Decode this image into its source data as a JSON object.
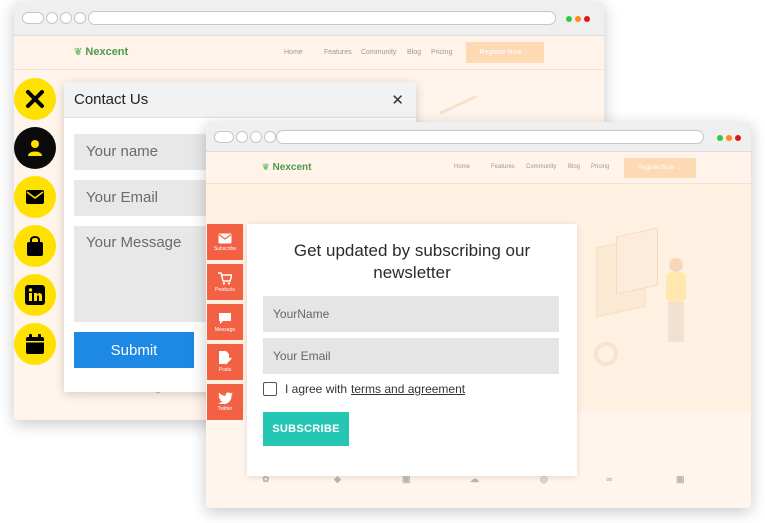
{
  "back_window": {
    "logo": "Nexcent",
    "nav": [
      "Home",
      "Features",
      "Community",
      "Blog",
      "Pricing"
    ],
    "register": "Register Now →"
  },
  "side_buttons": [
    {
      "icon": "close-icon",
      "style": "yellow"
    },
    {
      "icon": "user-icon",
      "style": "dark"
    },
    {
      "icon": "mail-icon",
      "style": "yellow"
    },
    {
      "icon": "bag-icon",
      "style": "yellow"
    },
    {
      "icon": "linkedin-icon",
      "style": "yellow"
    },
    {
      "icon": "calendar-icon",
      "style": "yellow"
    }
  ],
  "contact_form": {
    "title": "Contact Us",
    "close": "✕",
    "name_placeholder": "Your name",
    "email_placeholder": "Your Email",
    "message_placeholder": "Your Message",
    "submit": "Submit"
  },
  "front_window": {
    "logo": "Nexcent",
    "nav": [
      "Home",
      "Features",
      "Community",
      "Blog",
      "Pricing"
    ],
    "register": "Register Now →",
    "tabs": [
      "Subscribe",
      "Products",
      "Message",
      "Posts",
      "Twitter"
    ]
  },
  "newsletter": {
    "title_line1": "Get updated by subscribing our",
    "title_line2": "newsletter",
    "name_placeholder": "YourName",
    "email_placeholder": "Your Email",
    "agree_text": "I agree with",
    "terms_link": "terms and agreement",
    "subscribe": "SUBSCRIBE"
  },
  "colors": {
    "yellow": "#ffe100",
    "submit_blue": "#1e88e5",
    "tab_orange": "#f26144",
    "subscribe_teal": "#26c6b5",
    "page_peach": "#fff5ec"
  }
}
